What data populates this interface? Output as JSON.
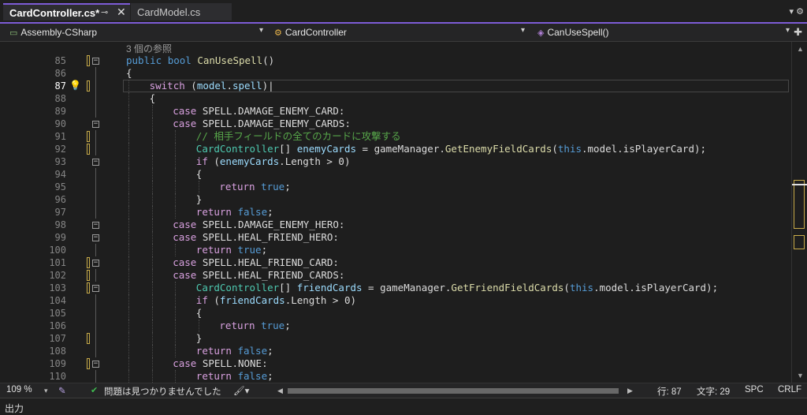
{
  "tabs": [
    {
      "label": "CardController.cs*",
      "pin": "⊸",
      "close": "✕"
    },
    {
      "label": "CardModel.cs"
    }
  ],
  "tabbar_right": "▾ ⚙",
  "navbar": {
    "assembly": "Assembly-CSharp",
    "class": "CardController",
    "member": "CanUseSpell()",
    "dropdown_arrow": "▾"
  },
  "code_header": "3 個の参照",
  "line_numbers": [
    "85",
    "86",
    "87",
    "88",
    "89",
    "90",
    "91",
    "92",
    "93",
    "94",
    "95",
    "96",
    "97",
    "98",
    "99",
    "100",
    "101",
    "102",
    "103",
    "104",
    "105",
    "106",
    "107",
    "108",
    "109",
    "110"
  ],
  "current_line_index": 2,
  "code_lines": [
    [
      [
        "kw",
        "public "
      ],
      [
        "kw",
        "bool "
      ],
      [
        "fn",
        "CanUseSpell"
      ],
      [
        "pl",
        "()"
      ]
    ],
    [
      [
        "pl",
        "{"
      ]
    ],
    [
      [
        "ctl",
        "switch "
      ],
      [
        "pl",
        "("
      ],
      [
        "id",
        "model"
      ],
      [
        "pl",
        "."
      ],
      [
        "id",
        "spell"
      ],
      [
        "pl",
        ")|"
      ]
    ],
    [
      [
        "pl",
        "{"
      ]
    ],
    [
      [
        "ctl",
        "case "
      ],
      [
        "pl",
        "SPELL.DAMAGE_ENEMY_CARD:"
      ]
    ],
    [
      [
        "ctl",
        "case "
      ],
      [
        "pl",
        "SPELL.DAMAGE_ENEMY_CARDS:"
      ]
    ],
    [
      [
        "cm",
        "// 相手フィールドの全てのカードに攻撃する"
      ]
    ],
    [
      [
        "ty",
        "CardController"
      ],
      [
        "pl",
        "[] "
      ],
      [
        "id",
        "enemyCards"
      ],
      [
        "pl",
        " = gameManager."
      ],
      [
        "fn",
        "GetEnemyFieldCards"
      ],
      [
        "pl",
        "("
      ],
      [
        "kw",
        "this"
      ],
      [
        "pl",
        ".model.isPlayerCard);"
      ]
    ],
    [
      [
        "ctl",
        "if "
      ],
      [
        "pl",
        "("
      ],
      [
        "id",
        "enemyCards"
      ],
      [
        "pl",
        ".Length > 0)"
      ]
    ],
    [
      [
        "pl",
        "{"
      ]
    ],
    [
      [
        "ctl",
        "return "
      ],
      [
        "kw",
        "true"
      ],
      [
        "pl",
        ";"
      ]
    ],
    [
      [
        "pl",
        "}"
      ]
    ],
    [
      [
        "ctl",
        "return "
      ],
      [
        "kw",
        "false"
      ],
      [
        "pl",
        ";"
      ]
    ],
    [
      [
        "ctl",
        "case "
      ],
      [
        "pl",
        "SPELL.DAMAGE_ENEMY_HERO:"
      ]
    ],
    [
      [
        "ctl",
        "case "
      ],
      [
        "pl",
        "SPELL.HEAL_FRIEND_HERO:"
      ]
    ],
    [
      [
        "ctl",
        "return "
      ],
      [
        "kw",
        "true"
      ],
      [
        "pl",
        ";"
      ]
    ],
    [
      [
        "ctl",
        "case "
      ],
      [
        "pl",
        "SPELL.HEAL_FRIEND_CARD:"
      ]
    ],
    [
      [
        "ctl",
        "case "
      ],
      [
        "pl",
        "SPELL.HEAL_FRIEND_CARDS:"
      ]
    ],
    [
      [
        "ty",
        "CardController"
      ],
      [
        "pl",
        "[] "
      ],
      [
        "id",
        "friendCards"
      ],
      [
        "pl",
        " = gameManager."
      ],
      [
        "fn",
        "GetFriendFieldCards"
      ],
      [
        "pl",
        "("
      ],
      [
        "kw",
        "this"
      ],
      [
        "pl",
        ".model.isPlayerCard);"
      ]
    ],
    [
      [
        "ctl",
        "if "
      ],
      [
        "pl",
        "("
      ],
      [
        "id",
        "friendCards"
      ],
      [
        "pl",
        ".Length > 0)"
      ]
    ],
    [
      [
        "pl",
        "{"
      ]
    ],
    [
      [
        "ctl",
        "return "
      ],
      [
        "kw",
        "true"
      ],
      [
        "pl",
        ";"
      ]
    ],
    [
      [
        "pl",
        "}"
      ]
    ],
    [
      [
        "ctl",
        "return "
      ],
      [
        "kw",
        "false"
      ],
      [
        "pl",
        ";"
      ]
    ],
    [
      [
        "ctl",
        "case "
      ],
      [
        "pl",
        "SPELL.NONE:"
      ]
    ],
    [
      [
        "ctl",
        "return "
      ],
      [
        "kw",
        "false"
      ],
      [
        "pl",
        ";"
      ]
    ]
  ],
  "code_indents": [
    0,
    0,
    1,
    1,
    2,
    2,
    3,
    3,
    3,
    3,
    4,
    3,
    3,
    2,
    2,
    3,
    2,
    2,
    3,
    3,
    3,
    4,
    3,
    3,
    2,
    3
  ],
  "status": {
    "zoom": "109 %",
    "zoom_arrow": "▾",
    "issues_icon": "✔",
    "issues": "問題は見つかりませんでした",
    "line": "行: 87",
    "column": "文字: 29",
    "whitespace": "SPC",
    "line_ending": "CRLF"
  },
  "bottom_panel": "出力"
}
